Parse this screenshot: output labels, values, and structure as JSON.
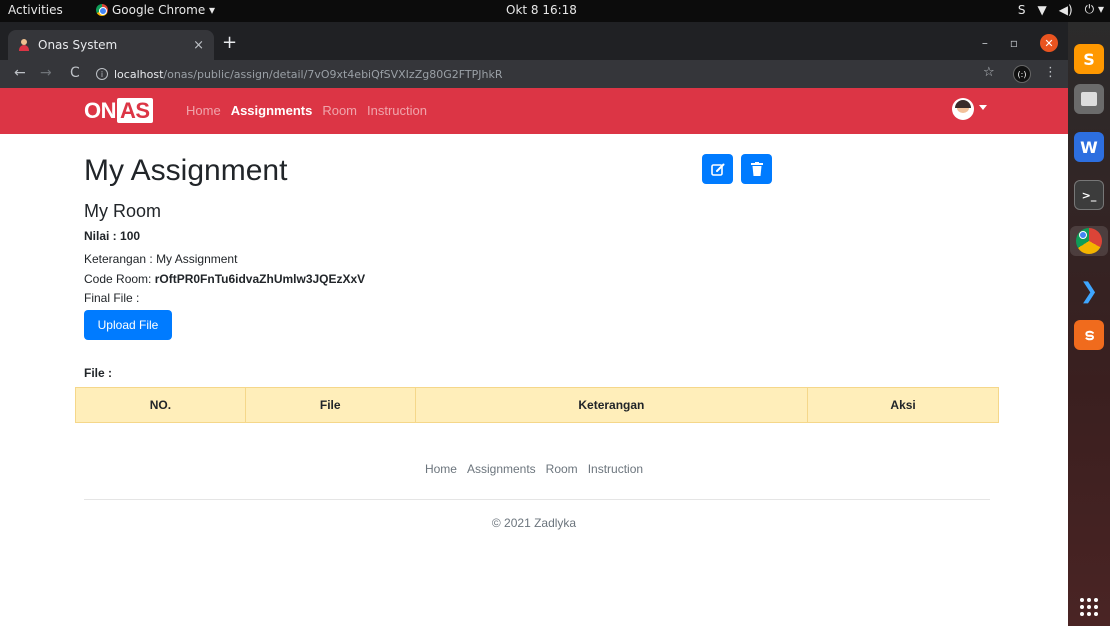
{
  "os": {
    "activities": "Activities",
    "app_name": "Google Chrome ▾",
    "clock": "Okt 8  16:18",
    "tray": [
      "S",
      "▼",
      "◀)",
      "⏻ ▾"
    ]
  },
  "browser": {
    "tab_title": "Onas System",
    "tab_close": "×",
    "new_tab": "+",
    "url_host": "localhost",
    "url_path": "/onas/public/assign/detail/7vO9xt4ebiQfSVXIzZg80G2FTPJhkR",
    "star": "☆",
    "ext_label": "(:)",
    "menu": "⋮",
    "win_min": "–",
    "win_max": "▫",
    "win_close": "✕"
  },
  "app": {
    "brand_on": "ON",
    "brand_as": "AS",
    "nav": [
      "Home",
      "Assignments",
      "Room",
      "Instruction"
    ],
    "active_nav": "Assignments",
    "accent_color": "#dc3545",
    "primary_color": "#007bff"
  },
  "assignment": {
    "title": "My Assignment",
    "room": "My Room",
    "nilai_label": "Nilai : ",
    "nilai_value": "100",
    "keterangan_label": "Keterangan : ",
    "keterangan_value": "My Assignment",
    "code_label": "Code Room: ",
    "code_value": "rOftPR0FnTu6idvaZhUmlw3JQEzXxV",
    "final_file_label": "Final File :",
    "upload_label": "Upload File",
    "file_label": "File :"
  },
  "table": {
    "headers": [
      "NO.",
      "File",
      "Keterangan",
      "Aksi"
    ]
  },
  "footer": {
    "links": [
      "Home",
      "Assignments",
      "Room",
      "Instruction"
    ],
    "copyright": "© 2021 Zadlyka"
  }
}
